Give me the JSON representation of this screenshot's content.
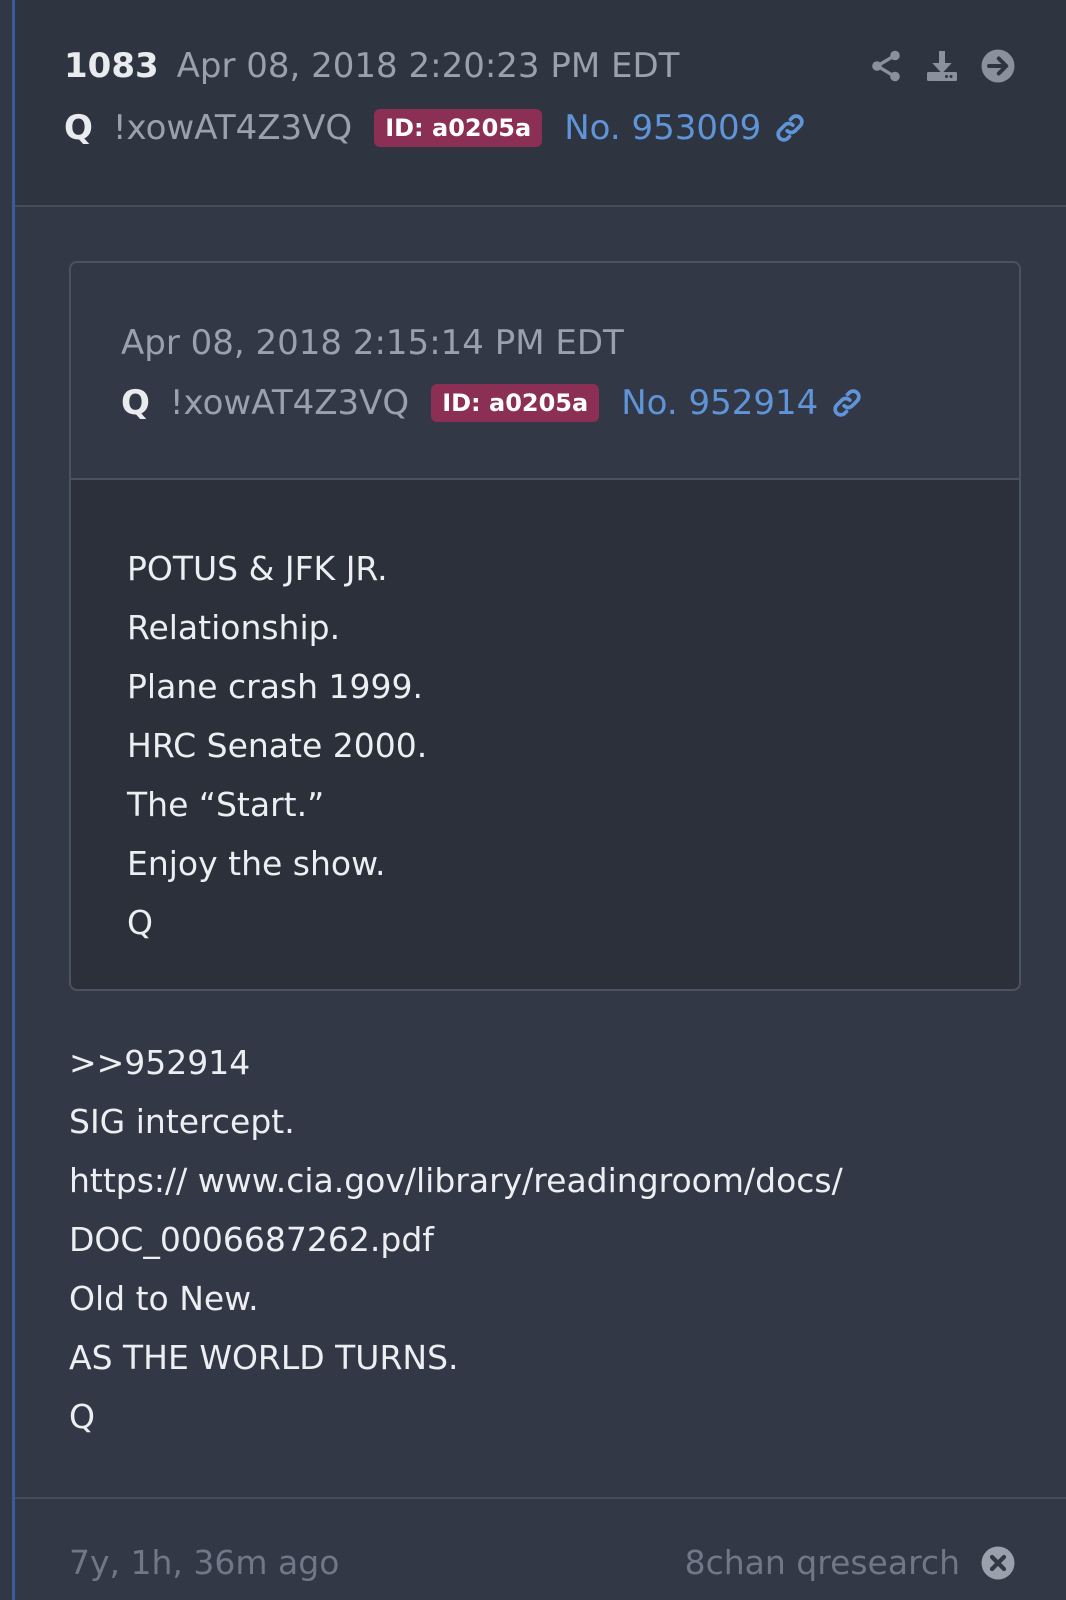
{
  "post": {
    "number": "1083",
    "date": "Apr 08, 2018 2:20:23 PM EDT",
    "name": "Q",
    "tripcode": "!xowAT4Z3VQ",
    "id_badge": "ID: a0205a",
    "post_no": "No. 953009"
  },
  "quoted": {
    "date": "Apr 08, 2018 2:15:14 PM EDT",
    "name": "Q",
    "tripcode": "!xowAT4Z3VQ",
    "id_badge": "ID: a0205a",
    "post_no": "No. 952914",
    "lines": [
      "POTUS & JFK JR.",
      "Relationship.",
      "Plane crash 1999.",
      "HRC Senate 2000.",
      "The “Start.”",
      "Enjoy the show.",
      "Q"
    ]
  },
  "reply": {
    "lines": [
      ">>952914",
      "SIG intercept.",
      "https:// www.cia.gov/library/readingroom/docs/",
      "DOC_0006687262.pdf",
      "Old to New.",
      "AS THE WORLD TURNS.",
      "Q"
    ]
  },
  "footer": {
    "age": "7y, 1h, 36m ago",
    "source": "8chan qresearch"
  },
  "icons": {
    "share": "share-icon",
    "download": "download-icon",
    "goto": "arrow-right-circle-icon",
    "link": "link-icon",
    "close": "close-circle-icon"
  },
  "colors": {
    "background": "#323845",
    "header": "#2e3440",
    "badge": "#8c2f55",
    "link": "#5f95d8",
    "accent": "#3b5aa0"
  }
}
